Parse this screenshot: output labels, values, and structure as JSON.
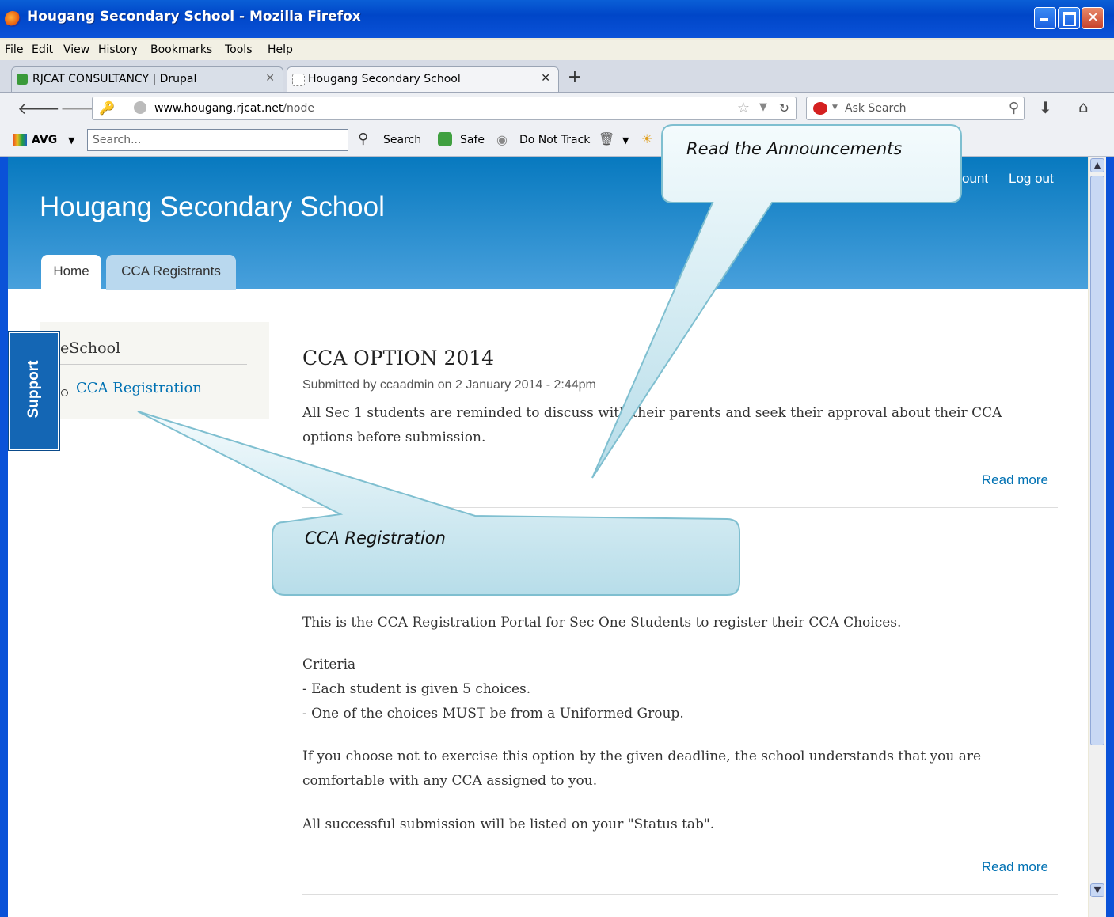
{
  "window": {
    "title": "Hougang Secondary School - Mozilla Firefox"
  },
  "menu": [
    "File",
    "Edit",
    "View",
    "History",
    "Bookmarks",
    "Tools",
    "Help"
  ],
  "tabs": [
    {
      "label": "RJCAT CONSULTANCY | Drupal",
      "active": false
    },
    {
      "label": "Hougang Secondary School",
      "active": true
    }
  ],
  "navbar": {
    "url_host": "www.hougang.rjcat.net",
    "url_path": "/node",
    "search_placeholder": "Ask Search"
  },
  "avg_toolbar": {
    "brand": "AVG",
    "search_placeholder": "Search...",
    "search_label": "Search",
    "safe_label": "Safe",
    "dnt_label": "Do Not Track"
  },
  "site": {
    "name": "Hougang Secondary School",
    "user_links": [
      "ount",
      "Log out"
    ],
    "tabs": [
      "Home",
      "CCA Registrants"
    ]
  },
  "sidebar": {
    "heading": "eSchool",
    "links": [
      "CCA Registration"
    ]
  },
  "support_label": "Support",
  "nodes": [
    {
      "title": "CCA OPTION 2014",
      "meta": "Submitted by ccaadmin on 2 January 2014 - 2:44pm",
      "body": "All Sec 1 students are reminded to discuss with their parents and seek their approval about their CCA options before submission.",
      "read_more": "Read more"
    },
    {
      "intro": "This is the CCA Registration Portal for Sec One Students to register their CCA Choices.",
      "criteria_title": "Criteria",
      "criteria": [
        "- Each student is given 5 choices.",
        "- One of the choices MUST be from a Uniformed Group."
      ],
      "p2": "If you choose not to exercise this option by the given deadline, the school understands that you are comfortable with any CCA assigned to you.",
      "p3": "All successful submission will be listed on your \"Status tab\".",
      "read_more": "Read more"
    }
  ],
  "callouts": {
    "announcements": "Read the Announcements",
    "registration": "CCA Registration"
  },
  "colors": {
    "header_blue": "#0779bf",
    "link_blue": "#0071b3",
    "callout_fill": "#c8e6f0",
    "support_blue": "#1466b4"
  }
}
